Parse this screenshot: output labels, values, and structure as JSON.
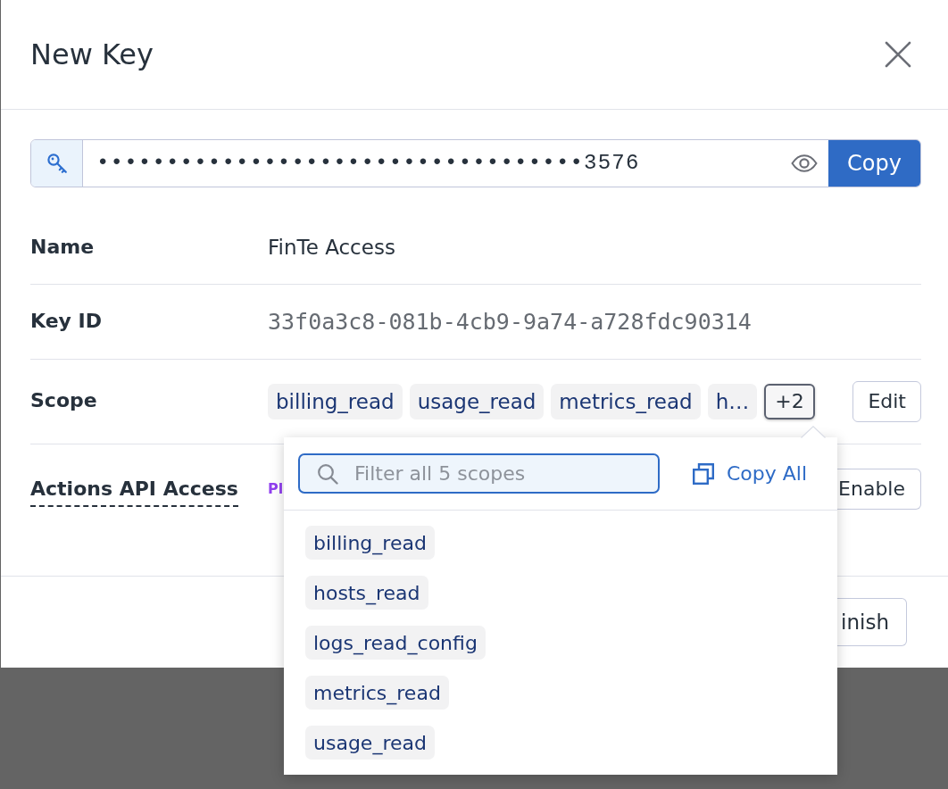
{
  "dialog": {
    "title": "New Key"
  },
  "api_key": {
    "value": "•••••••••••••••••••••••••••••••••••3576",
    "copy_button": "Copy"
  },
  "details": [
    {
      "kind": "text",
      "label": "Name",
      "tooltip_hint": false,
      "value": "FinTe Access"
    },
    {
      "kind": "mono",
      "label": "Key ID",
      "tooltip_hint": false,
      "value": "33f0a3c8-081b-4cb9-9a74-a728fdc90314"
    },
    {
      "kind": "tags",
      "label": "Scope",
      "tooltip_hint": false,
      "tags": [
        "billing_read",
        "usage_read",
        "metrics_read",
        "h…"
      ],
      "more": {
        "label": "+2",
        "expanded": true
      },
      "button": "Edit"
    },
    {
      "kind": "action",
      "label": "Actions API Access",
      "tooltip_hint": true,
      "value": "Pl",
      "button": "Enable"
    }
  ],
  "footer": {
    "button": "inish"
  },
  "scope_popover": {
    "search": {
      "placeholder": "Filter all 5 scopes"
    },
    "copy_all": "Copy All",
    "scopes": [
      "billing_read",
      "hosts_read",
      "logs_read_config",
      "metrics_read",
      "usage_read"
    ]
  }
}
